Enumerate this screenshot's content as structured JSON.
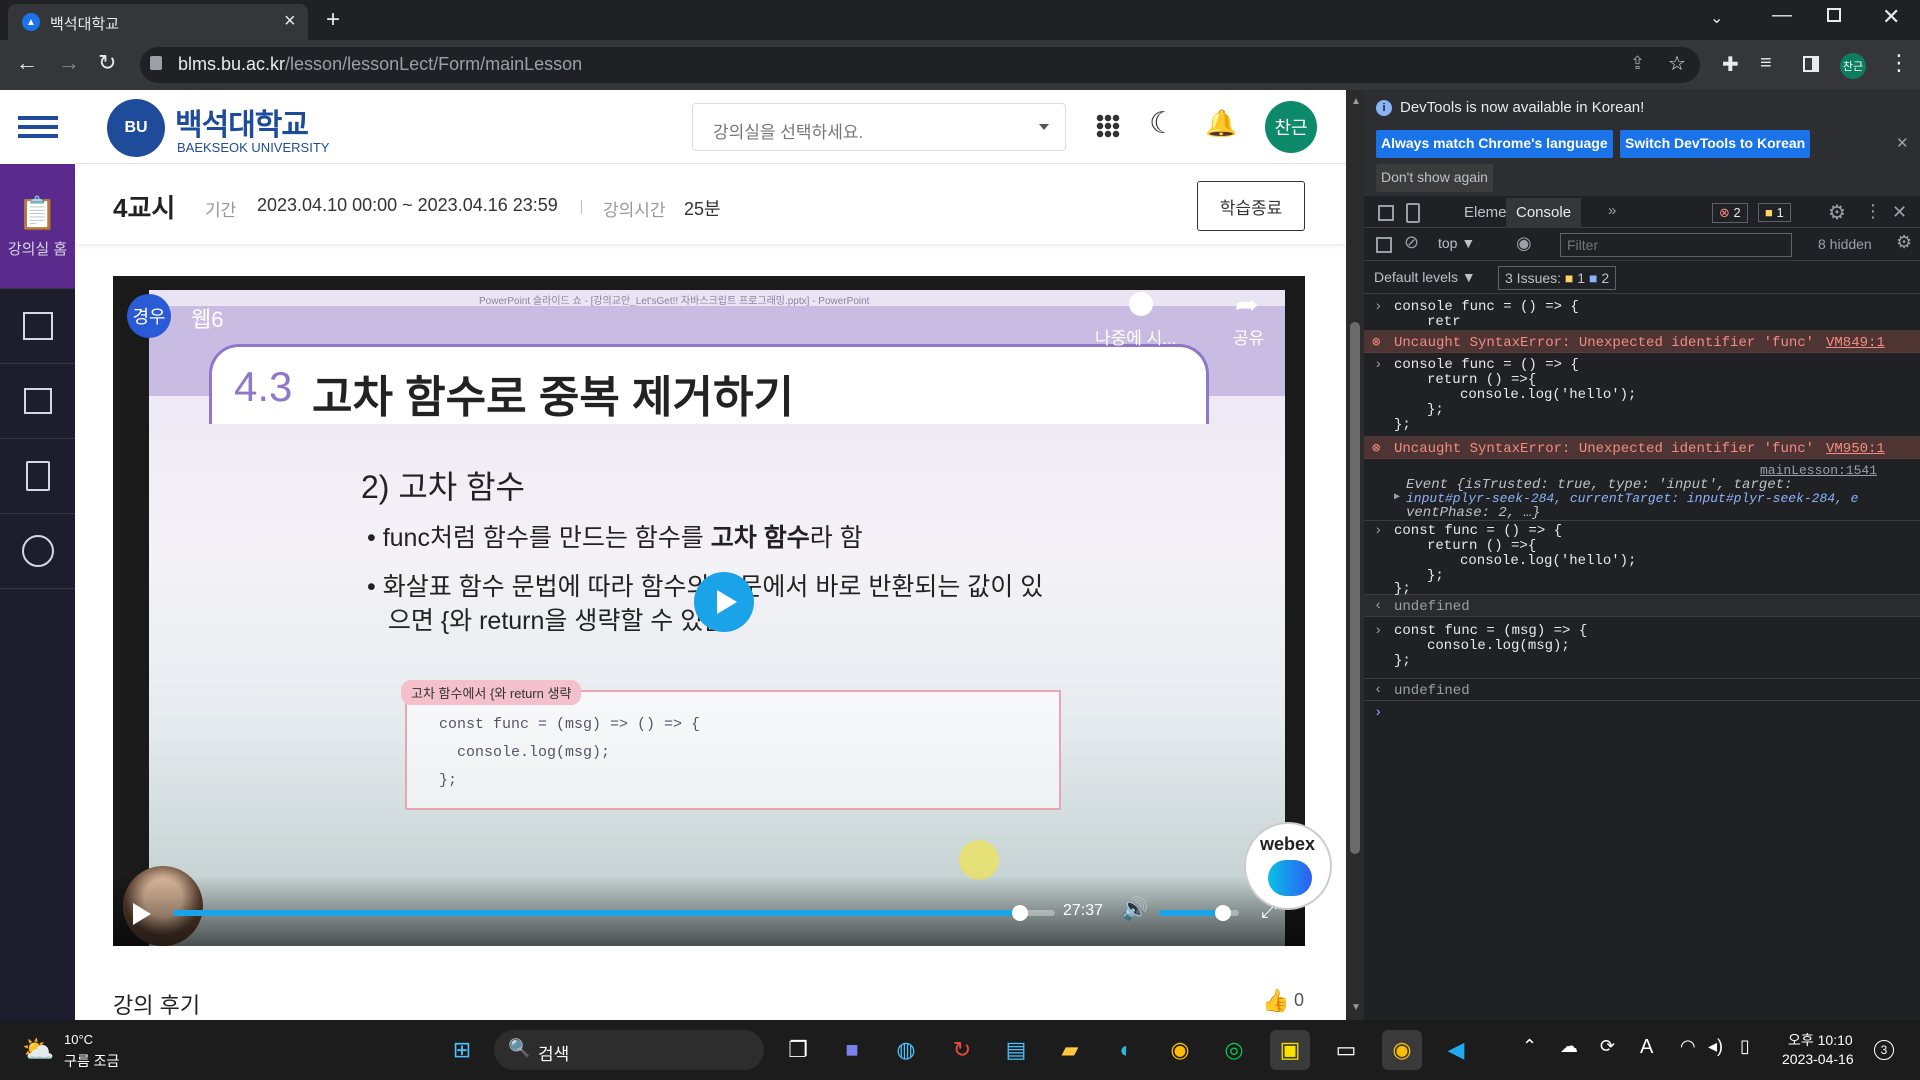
{
  "browser": {
    "tab_title": "백석대학교",
    "tab_close": "×",
    "new_tab": "+",
    "url_host": "blms.bu.ac.kr",
    "url_path": "/lesson/lessonLect/Form/mainLesson",
    "profile_initial": "찬근"
  },
  "site": {
    "logo_ko": "백석대학교",
    "logo_en": "BAEKSEOK UNIVERSITY",
    "logo_badge": "BU",
    "select_placeholder": "강의실을 선택하세요.",
    "user_avatar": "찬근"
  },
  "sidebar": {
    "items": [
      {
        "label": "강의실 홈",
        "icon": "clipboard-icon",
        "active": true
      },
      {
        "label": "",
        "icon": "book-icon"
      },
      {
        "label": "",
        "icon": "list-icon"
      },
      {
        "label": "",
        "icon": "clipboard-check-icon"
      },
      {
        "label": "",
        "icon": "pie-chart-icon"
      }
    ]
  },
  "lesson": {
    "title": "4교시",
    "period_label": "기간",
    "period_value": "2023.04.10 00:00 ~ 2023.04.16 23:59",
    "time_label": "강의시간",
    "time_value": "25분",
    "end_button": "학습종료"
  },
  "video": {
    "window_title": "PowerPoint 슬라이드 쇼 - [강의교안_Let'sGet!! 자바스크립트 프로그래밍.pptx] - PowerPoint",
    "channel_badge": "경우",
    "channel_name": "웹6",
    "watch_later": "나중에 시...",
    "share": "공유",
    "slide_number": "4.3",
    "slide_title": "고차 함수로 중복 제거하기",
    "slide_subtitle": "2) 고차 함수",
    "bullet1_pre": "func처럼 함수를 만드는 함수를 ",
    "bullet1_bold": "고차 함수",
    "bullet1_post": "라 함",
    "bullet2_line1": "화살표 함수 문법에 따라 함수의 본문에서 바로 반환되는 값이 있",
    "bullet2_line2": "으면 {와 return을 생략할 수 있음",
    "code_caption": "고차 함수에서 {와 return 생략",
    "code_line1": "const func = (msg) => () => {",
    "code_line2": "console.log(msg);",
    "code_line3": "};",
    "time": "27:37",
    "progress": 0.96,
    "volume": 0.8,
    "webex": "webex"
  },
  "review": {
    "title": "강의 후기",
    "likes": "0"
  },
  "devtools": {
    "banner": "DevTools is now available in Korean!",
    "btn_match": "Always match Chrome's language",
    "btn_switch": "Switch DevTools to Korean",
    "btn_dont": "Don't show again",
    "tabs": [
      "Elements",
      "Console"
    ],
    "active_tab": "Console",
    "error_count": "2",
    "warn_count": "1",
    "context": "top",
    "filter_placeholder": "Filter",
    "hidden": "8 hidden",
    "levels": "Default levels ▼",
    "issues_label": "3 Issues:",
    "issues_warn": "1",
    "issues_info": "2",
    "console": {
      "in1_l1": "console func = () => {",
      "in1_l2": "retr",
      "err1": "Uncaught SyntaxError: Unexpected identifier 'func'",
      "err1_src": "VM849:1",
      "in2_l1": "console func = () => {",
      "in2_l2": "return () =>{",
      "in2_l3": "console.log('hello');",
      "in2_l4": "};",
      "in2_l5": "};",
      "err2": "Uncaught SyntaxError: Unexpected identifier 'func'",
      "err2_src": "VM950:1",
      "log_src": "mainLesson:1541",
      "ev_l1": "Event {isTrusted: true, type: 'input', target:",
      "ev_l2": "input#plyr-seek-284, currentTarget: input#plyr-seek-284, e",
      "ev_l3": "ventPhase: 2, …}",
      "in3_l1": "const func = () => {",
      "in3_l2": "return () =>{",
      "in3_l3": "console.log('hello');",
      "in3_l4": "};",
      "in3_l5": "};",
      "out1": "undefined",
      "in4_l1": "const func = (msg) => {",
      "in4_l2": "console.log(msg);",
      "in4_l3": "};",
      "out2": "undefined"
    }
  },
  "taskbar": {
    "temp": "10°C",
    "weather": "구름 조금",
    "search": "검색",
    "time": "오후 10:10",
    "date": "2023-04-16",
    "notifications": "3"
  }
}
